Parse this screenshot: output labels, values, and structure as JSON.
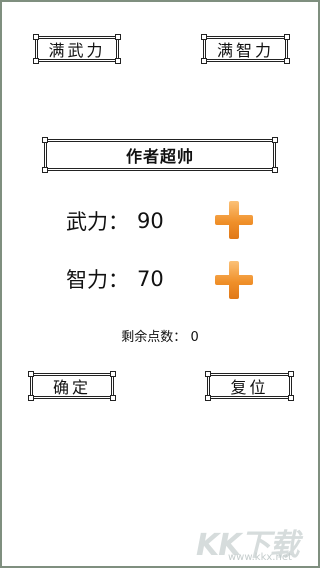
{
  "top_buttons": {
    "full_force": "满武力",
    "full_intel": "满智力"
  },
  "title": "作者超帅",
  "stats": {
    "force_label": "武力：",
    "force_value": "90",
    "intel_label": "智力：",
    "intel_value": "70"
  },
  "points": {
    "label": "剩余点数：",
    "value": "0"
  },
  "bottom_buttons": {
    "confirm": "确定",
    "reset": "复位"
  },
  "watermark": {
    "brand": "KK下载",
    "url": "www.kkx.net"
  },
  "colors": {
    "plus_orange": "#f0902a",
    "plus_light": "#fbc178",
    "border": "#222222"
  }
}
